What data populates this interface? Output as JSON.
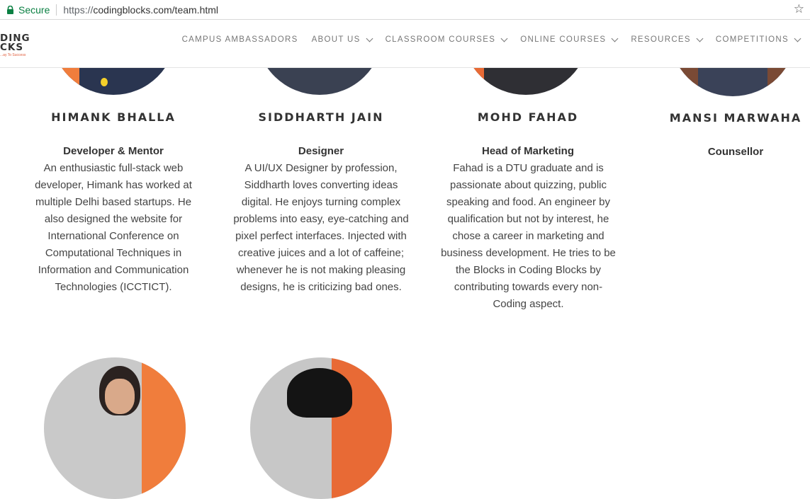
{
  "browser": {
    "secure_label": "Secure",
    "url_protocol": "https://",
    "url_rest": "codingblocks.com/team.html"
  },
  "site": {
    "logo_line1": "DING",
    "logo_line2": "CKS",
    "logo_tagline": "...ay To Success",
    "nav": [
      {
        "label": "CAMPUS AMBASSADORS"
      },
      {
        "label": "ABOUT US"
      },
      {
        "label": "CLASSROOM COURSES"
      },
      {
        "label": "ONLINE COURSES"
      },
      {
        "label": "RESOURCES"
      },
      {
        "label": "COMPETITIONS"
      }
    ]
  },
  "team": [
    {
      "name": "HIMANK BHALLA",
      "role": "Developer & Mentor",
      "bio": "An enthusiastic full-stack web developer, Himank has worked at multiple Delhi based startups. He also designed the website for International Conference on Computational Techniques in Information and Communication Technologies (ICCTICT)."
    },
    {
      "name": "SIDDHARTH JAIN",
      "role": "Designer",
      "bio": "A UI/UX Designer by profession, Siddharth loves converting ideas digital. He enjoys turning complex problems into easy, eye-catching and pixel perfect interfaces. Injected with creative juices and a lot of caffeine; whenever he is not making pleasing designs, he is criticizing bad ones."
    },
    {
      "name": "MOHD FAHAD",
      "role": "Head of Marketing",
      "bio": "Fahad is a DTU graduate and is passionate about quizzing, public speaking and food. An engineer by qualification but not by interest, he chose a career in marketing and business development. He tries to be the Blocks in Coding Blocks by contributing towards every non-Coding aspect."
    },
    {
      "name": "MANSI MARWAHA",
      "role": "Counsellor",
      "bio": ""
    }
  ],
  "colors": {
    "accent": "#f07d3c",
    "avatar_dark": "#2f3440",
    "secure_green": "#0b8043"
  }
}
